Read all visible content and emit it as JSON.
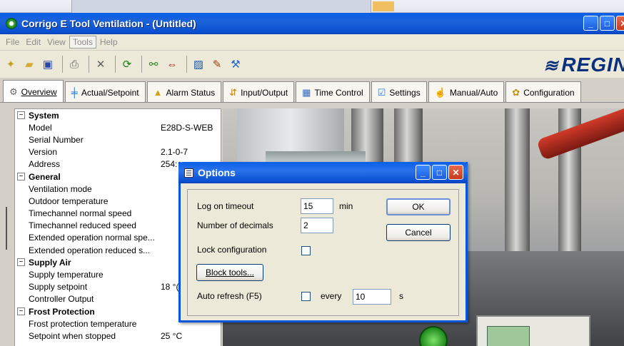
{
  "window": {
    "title": "Corrigo E Tool Ventilation - (Untitled)"
  },
  "menu": [
    {
      "label": "File"
    },
    {
      "label": "Edit"
    },
    {
      "label": "View"
    },
    {
      "label": "Tools"
    },
    {
      "label": "Help"
    }
  ],
  "toolbar": {
    "icons": [
      "new-icon",
      "open-folder-icon",
      "save-icon",
      "print-icon",
      "delete-icon",
      "refresh-icon",
      "connect-icon",
      "transfer-icon",
      "chart-icon",
      "edit-icon",
      "tools-icon"
    ],
    "logo": "REGIN"
  },
  "tabs": [
    {
      "label": "Overview",
      "icon": "gear-icon"
    },
    {
      "label": "Actual/Setpoint",
      "icon": "setpoint-icon"
    },
    {
      "label": "Alarm Status",
      "icon": "alarm-icon"
    },
    {
      "label": "Input/Output",
      "icon": "io-icon"
    },
    {
      "label": "Time Control",
      "icon": "calendar-icon"
    },
    {
      "label": "Settings",
      "icon": "settings-icon"
    },
    {
      "label": "Manual/Auto",
      "icon": "manual-icon"
    },
    {
      "label": "Configuration",
      "icon": "configuration-icon"
    }
  ],
  "tree": [
    {
      "type": "group",
      "label": "System"
    },
    {
      "type": "item",
      "label": "Model",
      "value": "E28D-S-WEB"
    },
    {
      "type": "item",
      "label": "Serial Number",
      "value": ""
    },
    {
      "type": "item",
      "label": "Version",
      "value": "2.1-0-7"
    },
    {
      "type": "item",
      "label": "Address",
      "value": "254:"
    },
    {
      "type": "group",
      "label": "General"
    },
    {
      "type": "item",
      "label": "Ventilation mode",
      "value": ""
    },
    {
      "type": "item",
      "label": "Outdoor temperature",
      "value": ""
    },
    {
      "type": "item",
      "label": "Timechannel normal speed",
      "value": ""
    },
    {
      "type": "item",
      "label": "Timechannel reduced speed",
      "value": ""
    },
    {
      "type": "item",
      "label": "Extended operation normal spe...",
      "value": ""
    },
    {
      "type": "item",
      "label": "Extended operation reduced s...",
      "value": ""
    },
    {
      "type": "group",
      "label": "Supply Air"
    },
    {
      "type": "item",
      "label": "Supply temperature",
      "value": ""
    },
    {
      "type": "item",
      "label": "Supply setpoint",
      "value": "18 °("
    },
    {
      "type": "item",
      "label": "Controller Output",
      "value": ""
    },
    {
      "type": "group",
      "label": "Frost Protection"
    },
    {
      "type": "item",
      "label": "Frost protection temperature",
      "value": ""
    },
    {
      "type": "item",
      "label": "Setpoint when stopped",
      "value": "25 °C"
    }
  ],
  "dialog": {
    "title": "Options",
    "log_on_timeout_label": "Log on timeout",
    "log_on_timeout_value": "15",
    "log_on_timeout_unit": "min",
    "decimals_label": "Number of decimals",
    "decimals_value": "2",
    "lock_label": "Lock configuration",
    "block_tools_label": "Block tools...",
    "auto_refresh_label": "Auto refresh (F5)",
    "every_label": "every",
    "every_value": "10",
    "every_unit": "s",
    "ok_label": "OK",
    "cancel_label": "Cancel"
  }
}
